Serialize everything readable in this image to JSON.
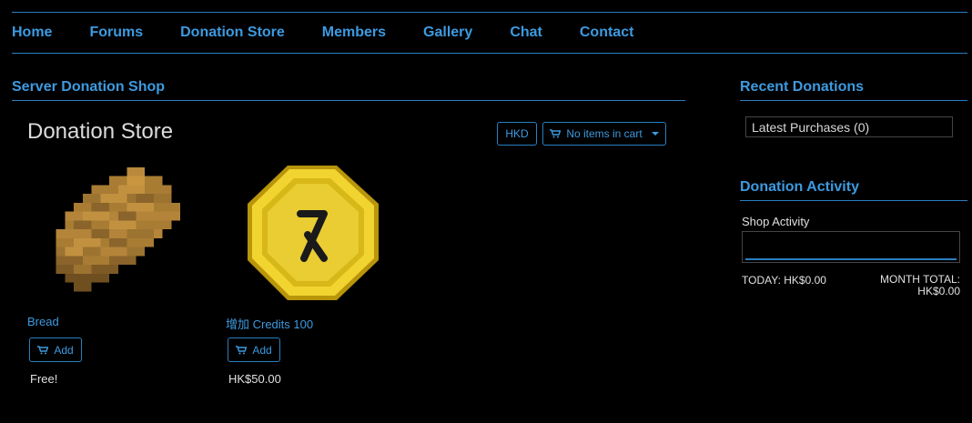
{
  "nav": {
    "items": [
      "Home",
      "Forums",
      "Donation Store",
      "Members",
      "Gallery",
      "Chat",
      "Contact"
    ]
  },
  "shop": {
    "section_title": "Server Donation Shop",
    "heading": "Donation Store",
    "currency": "HKD",
    "cart_label": "No items in cart",
    "products": [
      {
        "name": "Bread",
        "add_label": "Add",
        "price": "Free!",
        "icon": "bread-icon"
      },
      {
        "name": "增加 Credits 100",
        "add_label": "Add",
        "price": "HK$50.00",
        "icon": "credits-coin-icon"
      }
    ]
  },
  "recent": {
    "title": "Recent Donations",
    "latest": "Latest Purchases (0)"
  },
  "activity": {
    "title": "Donation Activity",
    "label": "Shop Activity",
    "today": "TODAY: HK$0.00",
    "month_line1": "MONTH TOTAL:",
    "month_line2": "HK$0.00"
  },
  "colors": {
    "accent": "#3d9ae0",
    "border": "#2a7fc0",
    "background": "#000000"
  }
}
